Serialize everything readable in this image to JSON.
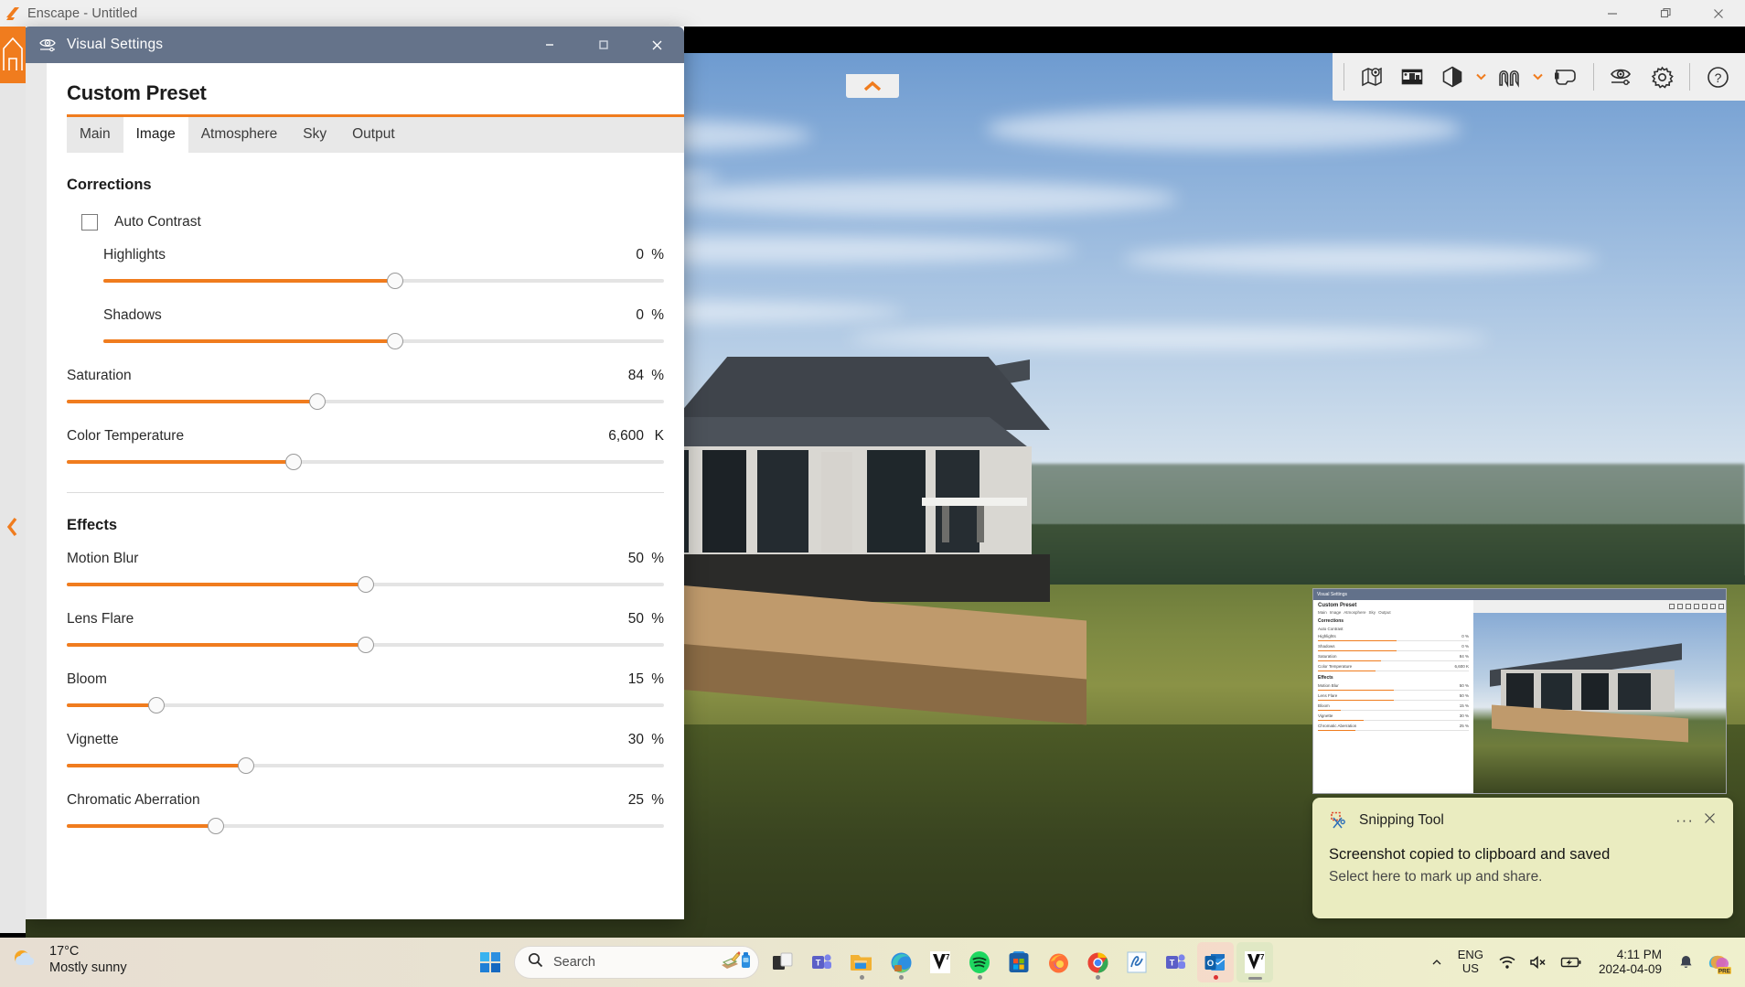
{
  "app": {
    "title": "Enscape - Untitled",
    "logo_icon": "enscape-logo-icon",
    "window_controls": {
      "minimize": "—",
      "restore": "❐",
      "close": "✕"
    }
  },
  "viewer_toolbar": {
    "items": [
      {
        "name": "map-pin-icon",
        "label": "Project Location"
      },
      {
        "name": "building-image-icon",
        "label": "Render Image"
      },
      {
        "name": "hexagon-split-icon",
        "label": "Rendering Quality"
      },
      {
        "name": "chevron-down-icon",
        "label": "Rendering Quality Options"
      },
      {
        "name": "views-arches-icon",
        "label": "Views"
      },
      {
        "name": "chevron-down-icon",
        "label": "Views Options"
      },
      {
        "name": "vr-headset-icon",
        "label": "Start VR"
      },
      {
        "name": "eye-visual-settings-icon",
        "label": "Visual Settings"
      },
      {
        "name": "gear-icon",
        "label": "Settings"
      },
      {
        "name": "help-icon",
        "label": "Help"
      }
    ],
    "collapse_up_icon": "chevron-up-icon",
    "collapse_left_icon": "chevron-left-icon"
  },
  "visual_settings": {
    "title": "Visual Settings",
    "title_icon": "visual-settings-eye-icon",
    "window_controls": {
      "minimize": "—",
      "maximize": "□",
      "close": "✕"
    },
    "preset_title": "Custom Preset",
    "tabs": [
      {
        "label": "Main",
        "active": false
      },
      {
        "label": "Image",
        "active": true
      },
      {
        "label": "Atmosphere",
        "active": false
      },
      {
        "label": "Sky",
        "active": false
      },
      {
        "label": "Output",
        "active": false
      }
    ],
    "sections": [
      {
        "title": "Corrections",
        "checkbox": {
          "label": "Auto Contrast",
          "checked": false
        },
        "sliders": [
          {
            "label": "Highlights",
            "value": "0",
            "unit": "%",
            "percent": 52,
            "indent": true
          },
          {
            "label": "Shadows",
            "value": "0",
            "unit": "%",
            "percent": 52,
            "indent": true
          },
          {
            "label": "Saturation",
            "value": "84",
            "unit": "%",
            "percent": 42,
            "indent": false
          },
          {
            "label": "Color Temperature",
            "value": "6,600",
            "unit": "K",
            "percent": 38,
            "indent": false
          }
        ]
      },
      {
        "title": "Effects",
        "checkbox": null,
        "sliders": [
          {
            "label": "Motion Blur",
            "value": "50",
            "unit": "%",
            "percent": 50,
            "indent": false
          },
          {
            "label": "Lens Flare",
            "value": "50",
            "unit": "%",
            "percent": 50,
            "indent": false
          },
          {
            "label": "Bloom",
            "value": "15",
            "unit": "%",
            "percent": 15,
            "indent": false
          },
          {
            "label": "Vignette",
            "value": "30",
            "unit": "%",
            "percent": 30,
            "indent": false
          },
          {
            "label": "Chromatic Aberration",
            "value": "25",
            "unit": "%",
            "percent": 25,
            "indent": false
          }
        ]
      }
    ],
    "accent_color": "#f07c1e",
    "titlebar_color": "#65738a"
  },
  "snip_thumbnail": {
    "window_title": "Visual Settings",
    "preset_title": "Custom Preset",
    "tabs": [
      "Main",
      "Image",
      "Atmosphere",
      "Sky",
      "Output"
    ],
    "section_one": "Corrections",
    "section_two": "Effects",
    "checkbox_label": "Auto Contrast",
    "rows_one": [
      {
        "label": "Highlights",
        "value": "0 %",
        "percent": 52
      },
      {
        "label": "Shadows",
        "value": "0 %",
        "percent": 52
      },
      {
        "label": "Saturation",
        "value": "84 %",
        "percent": 42
      },
      {
        "label": "Color Temperature",
        "value": "6,600 K",
        "percent": 38
      }
    ],
    "rows_two": [
      {
        "label": "Motion Blur",
        "value": "50 %",
        "percent": 50
      },
      {
        "label": "Lens Flare",
        "value": "50 %",
        "percent": 50
      },
      {
        "label": "Bloom",
        "value": "15 %",
        "percent": 15
      },
      {
        "label": "Vignette",
        "value": "30 %",
        "percent": 30
      },
      {
        "label": "Chromatic Aberration",
        "value": "25 %",
        "percent": 25
      }
    ]
  },
  "toast": {
    "app_name": "Snipping Tool",
    "app_icon": "snipping-tool-icon",
    "more_icon": "more-dots-icon",
    "close_icon": "close-icon",
    "title": "Screenshot copied to clipboard and saved",
    "subtitle": "Select here to mark up and share."
  },
  "taskbar": {
    "weather": {
      "temperature": "17°C",
      "condition": "Mostly sunny",
      "icon": "sun-cloud-icon"
    },
    "start": {
      "icon": "windows-start-icon",
      "label": "Start"
    },
    "search": {
      "placeholder": "Search",
      "icon": "search-icon",
      "illustration": "copilot-notebook-icon"
    },
    "apps": [
      {
        "name": "task-view",
        "label": "Task View",
        "state": "none"
      },
      {
        "name": "teams-classic",
        "label": "Microsoft Teams",
        "state": "none"
      },
      {
        "name": "file-explorer",
        "label": "File Explorer",
        "state": "running"
      },
      {
        "name": "microsoft-edge",
        "label": "Microsoft Edge",
        "state": "running"
      },
      {
        "name": "vray-7",
        "label": "Chaos V-Ray 7",
        "state": "none"
      },
      {
        "name": "spotify",
        "label": "Spotify",
        "state": "running"
      },
      {
        "name": "microsoft-store",
        "label": "Microsoft Store",
        "state": "none"
      },
      {
        "name": "firefox",
        "label": "Mozilla Firefox",
        "state": "none"
      },
      {
        "name": "google-chrome",
        "label": "Google Chrome",
        "state": "running"
      },
      {
        "name": "sketchup",
        "label": "SketchUp",
        "state": "none"
      },
      {
        "name": "teams-new",
        "label": "Microsoft Teams (new)",
        "state": "none"
      },
      {
        "name": "outlook",
        "label": "Outlook",
        "state": "alert"
      },
      {
        "name": "vray-7-active",
        "label": "Chaos V-Ray 7",
        "state": "active"
      }
    ],
    "tray": {
      "chevron_icon": "chevron-up-icon",
      "language": {
        "line1": "ENG",
        "line2": "US"
      },
      "wifi_icon": "wifi-icon",
      "volume_icon": "speaker-muted-icon",
      "battery_icon": "battery-charging-icon",
      "time": "4:11 PM",
      "date": "2024-04-09",
      "bell_icon": "notification-bell-icon",
      "copilot": {
        "icon": "copilot-icon",
        "badge": "PRE"
      }
    }
  }
}
